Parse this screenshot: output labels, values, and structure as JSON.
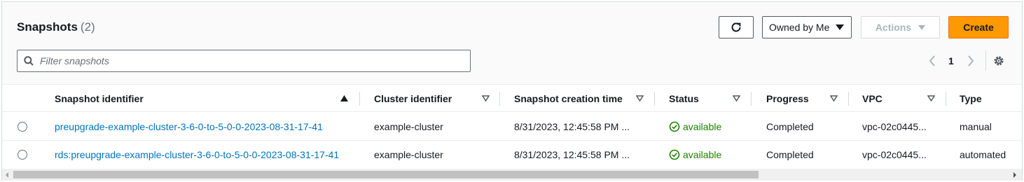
{
  "header": {
    "title": "Snapshots",
    "count": "(2)"
  },
  "toolbar": {
    "refresh_icon": "refresh-icon",
    "owner_filter": "Owned by Me",
    "actions_label": "Actions",
    "create_label": "Create"
  },
  "search": {
    "placeholder": "Filter snapshots",
    "value": ""
  },
  "pagination": {
    "current_page": "1"
  },
  "table": {
    "columns": [
      "Snapshot identifier",
      "Cluster identifier",
      "Snapshot creation time",
      "Status",
      "Progress",
      "VPC",
      "Type"
    ],
    "sorted_column": "Snapshot identifier",
    "sort_direction": "ascending",
    "rows": [
      {
        "snapshot_identifier": "preupgrade-example-cluster-3-6-0-to-5-0-0-2023-08-31-17-41",
        "cluster_identifier": "example-cluster",
        "creation_time": "8/31/2023, 12:45:58 PM ...",
        "status": "available",
        "progress": "Completed",
        "vpc": "vpc-02c0445...",
        "type": "manual"
      },
      {
        "snapshot_identifier": "rds:preupgrade-example-cluster-3-6-0-to-5-0-0-2023-08-31-17-41",
        "cluster_identifier": "example-cluster",
        "creation_time": "8/31/2023, 12:45:58 PM ...",
        "status": "available",
        "progress": "Completed",
        "vpc": "vpc-02c0445...",
        "type": "automated"
      }
    ]
  },
  "colors": {
    "accent": "#ff9900",
    "link": "#0073bb",
    "status_ok": "#1d8102"
  }
}
